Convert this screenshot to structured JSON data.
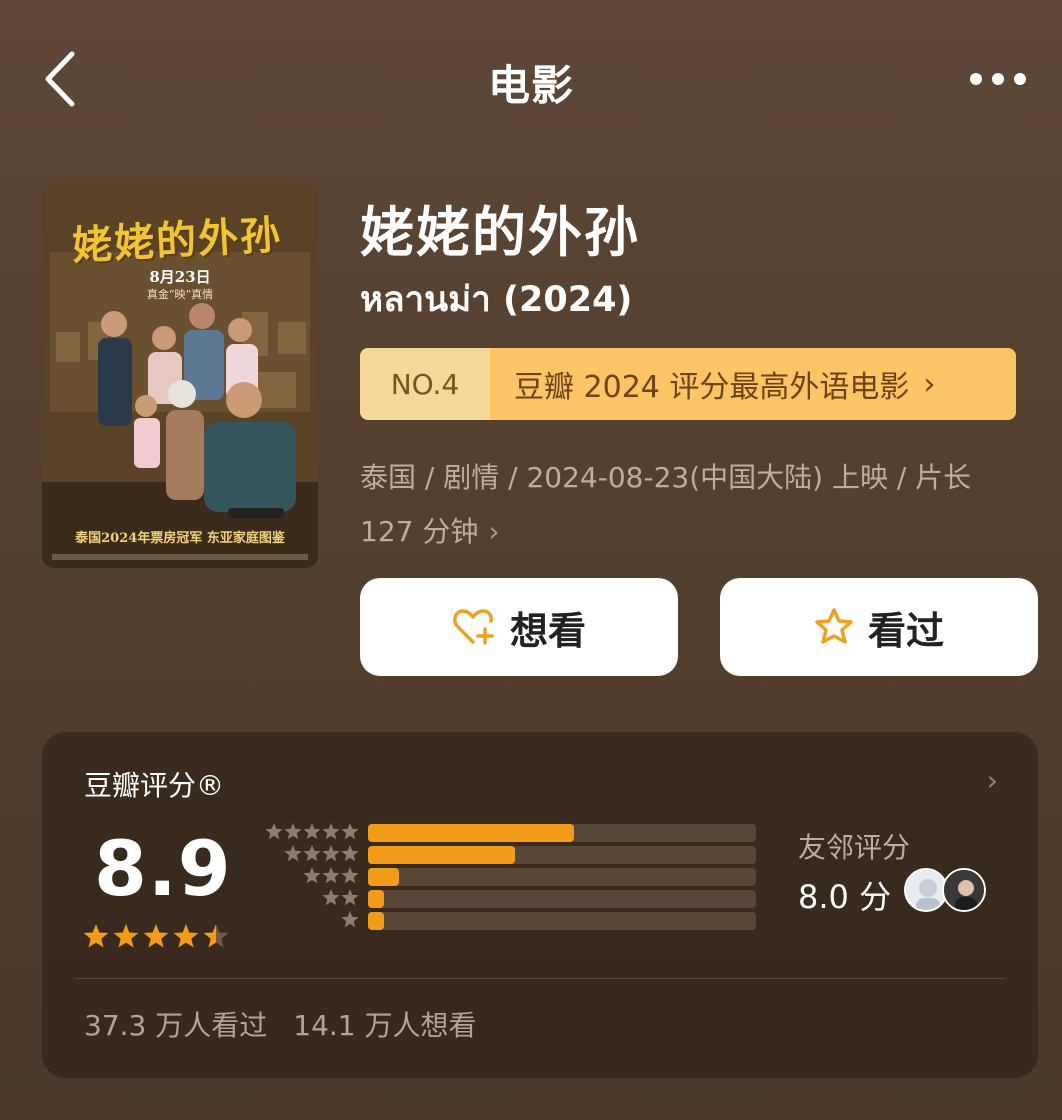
{
  "header": {
    "title": "电影"
  },
  "poster": {
    "title": "姥姥的外孙",
    "date": "8月23日",
    "tagline": "真金“映”真情",
    "bottom_text": "泰国2024年票房冠军  东亚家庭图鉴"
  },
  "movie": {
    "title": "姥姥的外孙",
    "original_title": "หลานม่า (2024)"
  },
  "rank": {
    "no": "NO.4",
    "text": "豆瓣 2024 评分最高外语电影",
    "chevron": "›"
  },
  "meta": {
    "line1": "泰国 / 剧情 / 2024-08-23(中国大陆) 上映 / 片长",
    "line2": "127 分钟",
    "chevron": "›"
  },
  "actions": {
    "wish_label": "想看",
    "seen_label": "看过"
  },
  "rating": {
    "header": "豆瓣评分®",
    "chevron": "›",
    "score": "8.9",
    "stars": 4.5,
    "distribution": [
      0.53,
      0.38,
      0.08,
      0.04,
      0.04
    ],
    "neighbor_label": "友邻评分",
    "neighbor_score": "8.0 分",
    "seen_count": "37.3 万人看过",
    "wish_count": "14.1 万人想看"
  },
  "colors": {
    "star": "#f39c1a",
    "bar_bg": "#5a4637",
    "accent": "#fbc566"
  },
  "icons": {
    "back": "chevron-left-icon",
    "more": "more-dots-icon",
    "wish": "heart-plus-icon",
    "seen": "star-outline-icon"
  }
}
